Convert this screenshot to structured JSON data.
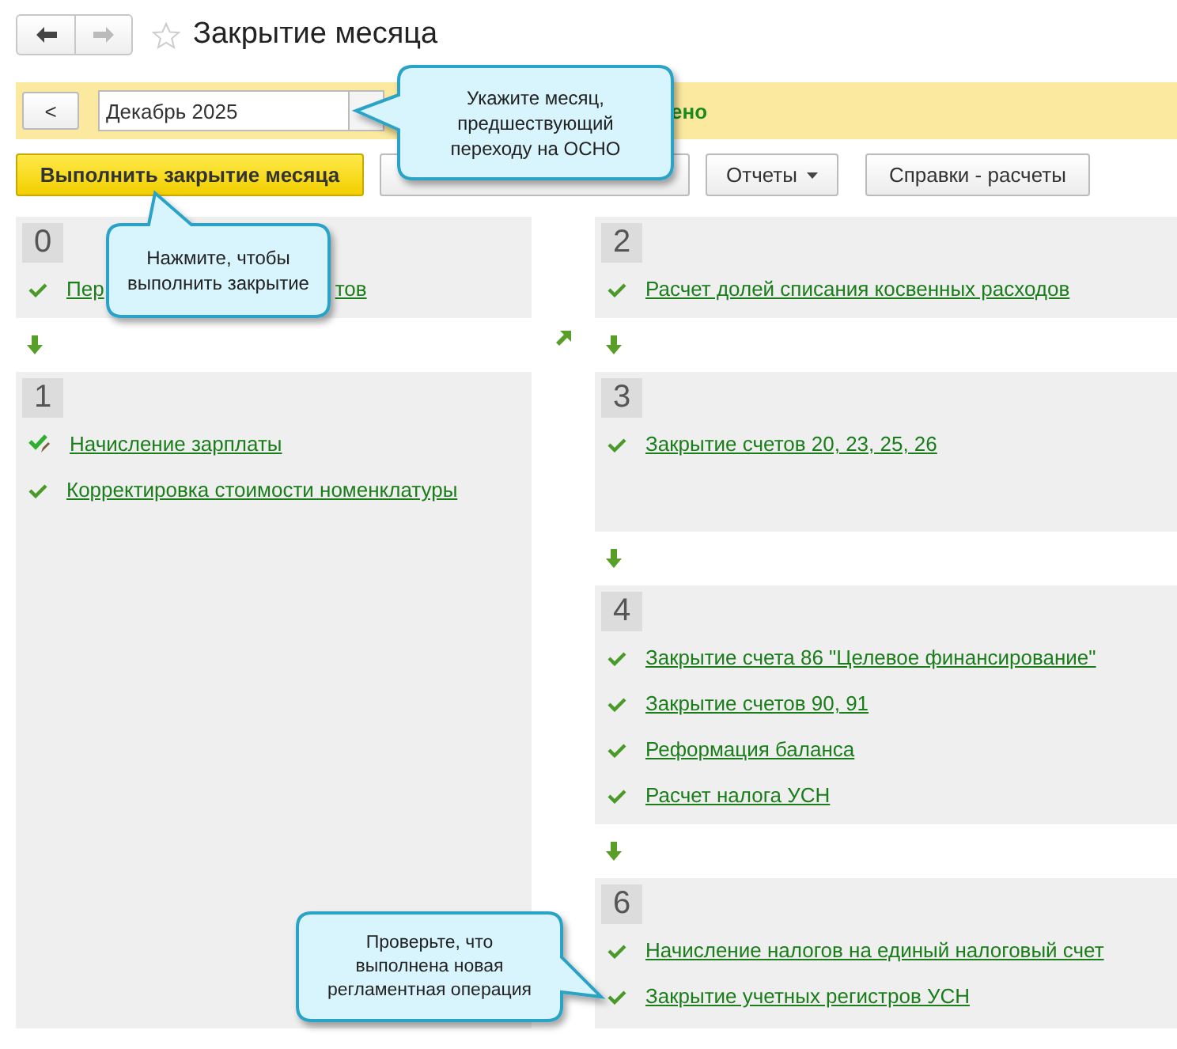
{
  "title": "Закрытие месяца",
  "period": {
    "prev_button": "<",
    "value": "Декабрь 2025",
    "status_text": "ено"
  },
  "toolbar": [
    {
      "kind": "primary",
      "label": "Выполнить закрытие месяца"
    },
    {
      "kind": "blank"
    },
    {
      "kind": "menu",
      "label": "Отчеты"
    },
    {
      "kind": "plain",
      "label": "Справки - расчеты"
    }
  ],
  "columns": [
    {
      "blocks": [
        {
          "number": "0",
          "items": [
            {
              "done": true,
              "edited": false,
              "text_start": "Пер",
              "text_end": "тов"
            }
          ]
        },
        {
          "number": "1",
          "items": [
            {
              "done": true,
              "edited": true,
              "text": "Начисление зарплаты"
            },
            {
              "done": true,
              "edited": false,
              "text": "Корректировка стоимости номенклатуры"
            }
          ]
        }
      ]
    },
    {
      "blocks": [
        {
          "number": "2",
          "items": [
            {
              "done": true,
              "edited": false,
              "text": "Расчет долей списания косвенных расходов"
            }
          ]
        },
        {
          "number": "3",
          "items": [
            {
              "done": true,
              "edited": false,
              "text": "Закрытие счетов 20, 23, 25, 26"
            }
          ]
        },
        {
          "number": "4",
          "items": [
            {
              "done": true,
              "edited": false,
              "text": "Закрытие счета 86 \"Целевое финансирование\""
            },
            {
              "done": true,
              "edited": false,
              "text": "Закрытие счетов 90, 91"
            },
            {
              "done": true,
              "edited": false,
              "text": "Реформация баланса"
            },
            {
              "done": true,
              "edited": false,
              "text": "Расчет налога УСН"
            }
          ]
        },
        {
          "number": "6",
          "items": [
            {
              "done": true,
              "edited": false,
              "text": "Начисление налогов на единый налоговый счет"
            },
            {
              "done": true,
              "edited": false,
              "text": "Закрытие учетных регистров УСН"
            }
          ]
        }
      ]
    }
  ],
  "callouts": [
    {
      "text": "Укажите месяц, предшествующий переходу на ОСНО"
    },
    {
      "text": "Нажмите, чтобы выполнить закрытие"
    },
    {
      "text": "Проверьте, что выполнена новая регламентная операция"
    }
  ]
}
